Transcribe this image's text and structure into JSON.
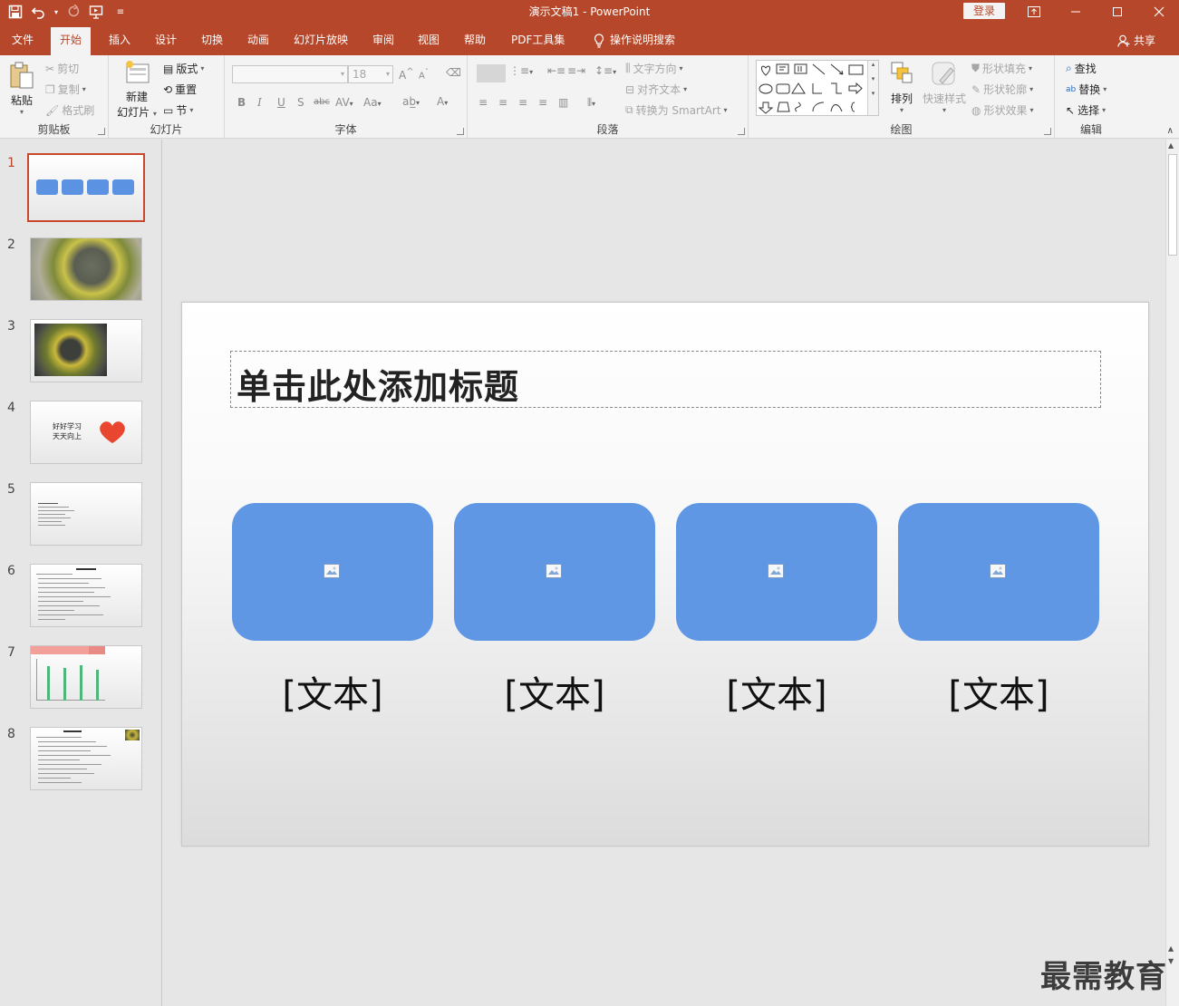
{
  "app": {
    "title": "演示文稿1  -  PowerPoint",
    "login": "登录",
    "share": "共享"
  },
  "tabs": [
    "文件",
    "开始",
    "插入",
    "设计",
    "切换",
    "动画",
    "幻灯片放映",
    "审阅",
    "视图",
    "帮助",
    "PDF工具集",
    "操作说明搜索"
  ],
  "active_tab": "开始",
  "ribbon": {
    "clipboard": {
      "label": "剪贴板",
      "paste": "粘贴",
      "cut": "剪切",
      "copy": "复制",
      "format_painter": "格式刷"
    },
    "slides": {
      "label": "幻灯片",
      "new_slide": "新建",
      "new_slide_2": "幻灯片",
      "layout": "版式",
      "reset": "重置",
      "section": "节"
    },
    "font": {
      "label": "字体",
      "font_name": "",
      "font_size": "18",
      "bold": "B",
      "italic": "I",
      "underline": "U",
      "shadow": "S",
      "strike": "abc",
      "spacing": "AV",
      "case": "Aa",
      "grow": "A",
      "shrink": "A",
      "color": "A"
    },
    "paragraph": {
      "label": "段落",
      "text_direction": "文字方向",
      "align_text": "对齐文本",
      "smartart": "转换为 SmartArt"
    },
    "drawing": {
      "label": "绘图",
      "arrange": "排列",
      "quick_styles": "快速样式",
      "shape_fill": "形状填充",
      "shape_outline": "形状轮廓",
      "shape_effects": "形状效果"
    },
    "editing": {
      "label": "编辑",
      "find": "查找",
      "replace": "替换",
      "select": "选择"
    }
  },
  "thumbnails": [
    {
      "num": "1",
      "kind": "boxes",
      "selected": true
    },
    {
      "num": "2",
      "kind": "photo"
    },
    {
      "num": "3",
      "kind": "photo-small"
    },
    {
      "num": "4",
      "kind": "heart",
      "line1": "好好学习",
      "line2": "天天向上"
    },
    {
      "num": "5",
      "kind": "text"
    },
    {
      "num": "6",
      "kind": "list"
    },
    {
      "num": "7",
      "kind": "chart"
    },
    {
      "num": "8",
      "kind": "list-image"
    }
  ],
  "slide": {
    "title_placeholder": "单击此处添加标题",
    "cards": [
      {
        "text": "[文本]",
        "color": "#6097e4"
      },
      {
        "text": "[文本]",
        "color": "#6097e4"
      },
      {
        "text": "[文本]",
        "color": "#6097e4"
      },
      {
        "text": "[文本]",
        "color": "#6097e4"
      }
    ]
  },
  "watermark": "最需教育",
  "colors": {
    "accent": "#b7472a",
    "card": "#6097e4",
    "selected_border": "#c9472c"
  }
}
